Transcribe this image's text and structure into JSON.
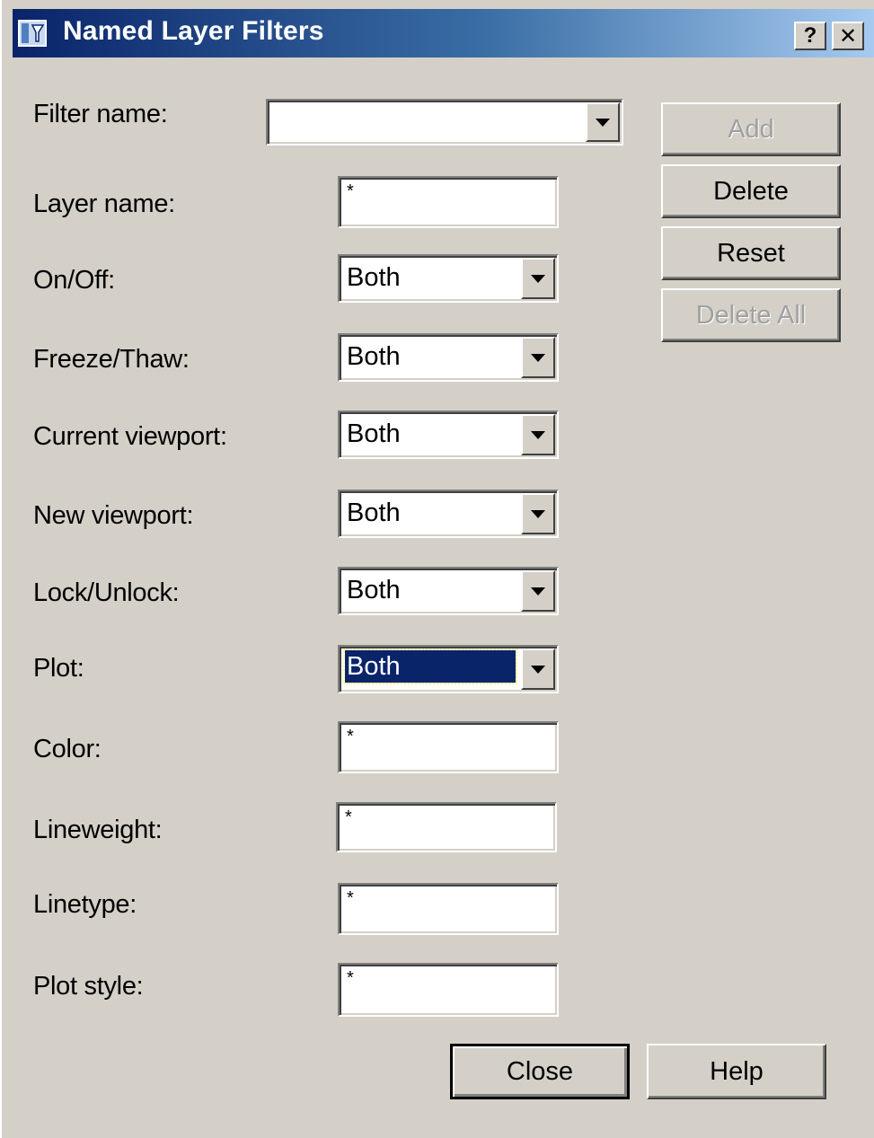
{
  "window": {
    "title": "Named Layer Filters",
    "help_button": "?",
    "close_button": "✕"
  },
  "fields": {
    "filter_name": {
      "label": "Filter name:",
      "value": ""
    },
    "layer_name": {
      "label": "Layer name:",
      "value": "*"
    },
    "on_off": {
      "label": "On/Off:",
      "value": "Both"
    },
    "freeze_thaw": {
      "label": "Freeze/Thaw:",
      "value": "Both"
    },
    "current_viewport": {
      "label": "Current viewport:",
      "value": "Both"
    },
    "new_viewport": {
      "label": "New viewport:",
      "value": "Both"
    },
    "lock_unlock": {
      "label": "Lock/Unlock:",
      "value": "Both"
    },
    "plot": {
      "label": "Plot:",
      "value": "Both"
    },
    "color": {
      "label": "Color:",
      "value": "*"
    },
    "lineweight": {
      "label": "Lineweight:",
      "value": "*"
    },
    "linetype": {
      "label": "Linetype:",
      "value": "*"
    },
    "plot_style": {
      "label": "Plot style:",
      "value": "*"
    }
  },
  "buttons": {
    "add": "Add",
    "delete": "Delete",
    "reset": "Reset",
    "delete_all": "Delete All",
    "close": "Close",
    "help": "Help"
  },
  "icons": {
    "window_icon": "layer-filter-icon",
    "dropdown": "chevron-down-icon"
  },
  "colors": {
    "titlebar_start": "#0a246a",
    "titlebar_end": "#a6caf0",
    "dialog_bg": "#d4d0c8",
    "selection": "#0a246a"
  }
}
